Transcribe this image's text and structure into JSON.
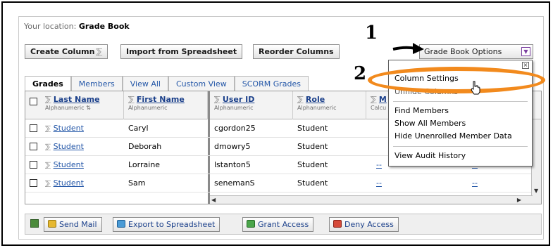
{
  "location": {
    "prefix": "Your location:",
    "name": "Grade Book"
  },
  "toolbar": {
    "create_column": "Create Column",
    "import": "Import from Spreadsheet",
    "reorder": "Reorder Columns",
    "options": "Grade Book Options"
  },
  "annotations": {
    "step1": "1",
    "step2": "2",
    "highlight_color": "#f28a1d"
  },
  "tabs": [
    "Grades",
    "Members",
    "View All",
    "Custom View",
    "SCORM Grades"
  ],
  "active_tab": "Grades",
  "columns": [
    {
      "name": "Last Name",
      "type": "Alphanumeric"
    },
    {
      "name": "First Name",
      "type": "Alphanumeric"
    },
    {
      "name": "User ID",
      "type": "Alphanumeric"
    },
    {
      "name": "Role",
      "type": "Alphanumeric"
    },
    {
      "name": "M",
      "type": "Calcu"
    }
  ],
  "rows": [
    {
      "last": "Student",
      "first": "Caryl",
      "userid": "cgordon25",
      "role": "Student"
    },
    {
      "last": "Student",
      "first": "Deborah",
      "userid": "dmowry5",
      "role": "Student"
    },
    {
      "last": "Student",
      "first": "Lorraine",
      "userid": "lstanton5",
      "role": "Student"
    },
    {
      "last": "Student",
      "first": "Sam",
      "userid": "senemanS",
      "role": "Student"
    }
  ],
  "cell_placeholder": "--",
  "menu": {
    "items": [
      "Column Settings",
      "Unhide Columns",
      "Find Members",
      "Show All Members",
      "Hide Unenrolled Member Data",
      "View Audit History"
    ]
  },
  "bottom": {
    "send_mail": "Send Mail",
    "export": "Export to Spreadsheet",
    "grant": "Grant Access",
    "deny": "Deny Access"
  }
}
